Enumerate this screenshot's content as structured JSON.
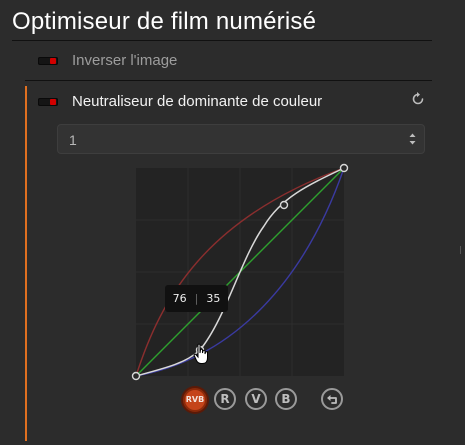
{
  "panel": {
    "title": "Optimiseur de film numérisé"
  },
  "modules": [
    {
      "label": "Inverser l'image",
      "enabled": true,
      "active": false
    },
    {
      "label": "Neutraliseur de dominante de couleur",
      "enabled": true,
      "active": true
    }
  ],
  "preset_select": {
    "value": "1"
  },
  "curve_tooltip": {
    "x_value": "76",
    "y_value": "35"
  },
  "channels": {
    "rvb_label": "RVB",
    "r_label": "R",
    "v_label": "V",
    "b_label": "B",
    "selected": "RVB"
  },
  "colors": {
    "accent": "#e07020",
    "led": "#d20000",
    "red_curve": "#8a2e2e",
    "green_curve": "#2ea02e",
    "blue_curve": "#3a3aa0",
    "rgb_curve": "#d8d8d8"
  },
  "icons": [
    "reset-icon",
    "dropdown-arrows-icon",
    "undo-icon",
    "hand-cursor-icon"
  ]
}
